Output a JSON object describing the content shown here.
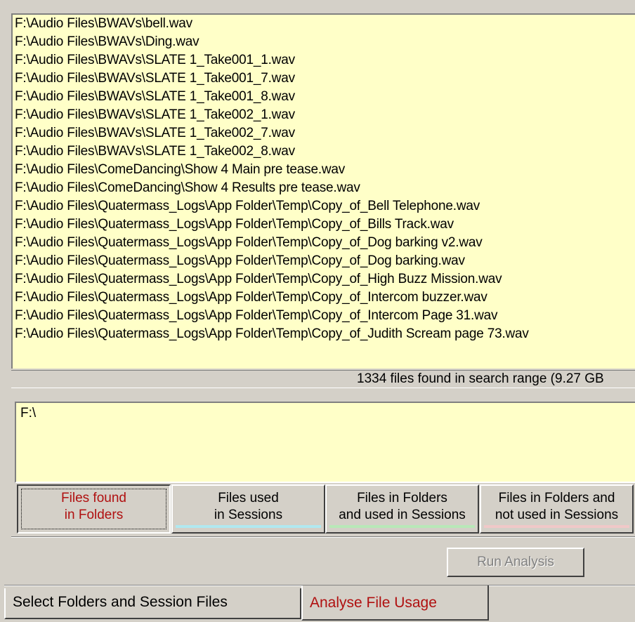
{
  "file_list": {
    "items": [
      "F:\\Audio Files\\BWAVs\\bell.wav",
      "F:\\Audio Files\\BWAVs\\Ding.wav",
      "F:\\Audio Files\\BWAVs\\SLATE 1_Take001_1.wav",
      "F:\\Audio Files\\BWAVs\\SLATE 1_Take001_7.wav",
      "F:\\Audio Files\\BWAVs\\SLATE 1_Take001_8.wav",
      "F:\\Audio Files\\BWAVs\\SLATE 1_Take002_1.wav",
      "F:\\Audio Files\\BWAVs\\SLATE 1_Take002_7.wav",
      "F:\\Audio Files\\BWAVs\\SLATE 1_Take002_8.wav",
      "F:\\Audio Files\\ComeDancing\\Show 4 Main pre tease.wav",
      "F:\\Audio Files\\ComeDancing\\Show 4 Results pre tease.wav",
      "F:\\Audio Files\\Quatermass_Logs\\App Folder\\Temp\\Copy_of_Bell Telephone.wav",
      "F:\\Audio Files\\Quatermass_Logs\\App Folder\\Temp\\Copy_of_Bills Track.wav",
      "F:\\Audio Files\\Quatermass_Logs\\App Folder\\Temp\\Copy_of_Dog barking v2.wav",
      "F:\\Audio Files\\Quatermass_Logs\\App Folder\\Temp\\Copy_of_Dog barking.wav",
      "F:\\Audio Files\\Quatermass_Logs\\App Folder\\Temp\\Copy_of_High Buzz Mission.wav",
      "F:\\Audio Files\\Quatermass_Logs\\App Folder\\Temp\\Copy_of_Intercom buzzer.wav",
      "F:\\Audio Files\\Quatermass_Logs\\App Folder\\Temp\\Copy_of_Intercom Page 31.wav",
      "F:\\Audio Files\\Quatermass_Logs\\App Folder\\Temp\\Copy_of_Judith Scream page 73.wav"
    ]
  },
  "status": {
    "text": "1334 files found in search range (9.27 GB"
  },
  "path_box": {
    "value": "F:\\"
  },
  "filters": [
    {
      "line1": "Files found",
      "line2": "in Folders",
      "color": "",
      "active": true
    },
    {
      "line1": "Files used",
      "line2": "in Sessions",
      "color": "#b0e8f0",
      "active": false
    },
    {
      "line1": "Files in Folders",
      "line2": "and used in Sessions",
      "color": "#b8e8b8",
      "active": false
    },
    {
      "line1": "Files in Folders and",
      "line2": "not used in Sessions",
      "color": "#f0c8c8",
      "active": false
    }
  ],
  "run_button": {
    "label": "Run Analysis",
    "enabled": false
  },
  "tabs": [
    {
      "label": "Select Folders and Session Files",
      "selected": false
    },
    {
      "label": "Analyse File Usage",
      "selected": true
    }
  ],
  "colors": {
    "list_bg": "#ffffc8",
    "accent_red": "#b01010",
    "window_bg": "#d4d0c8"
  }
}
